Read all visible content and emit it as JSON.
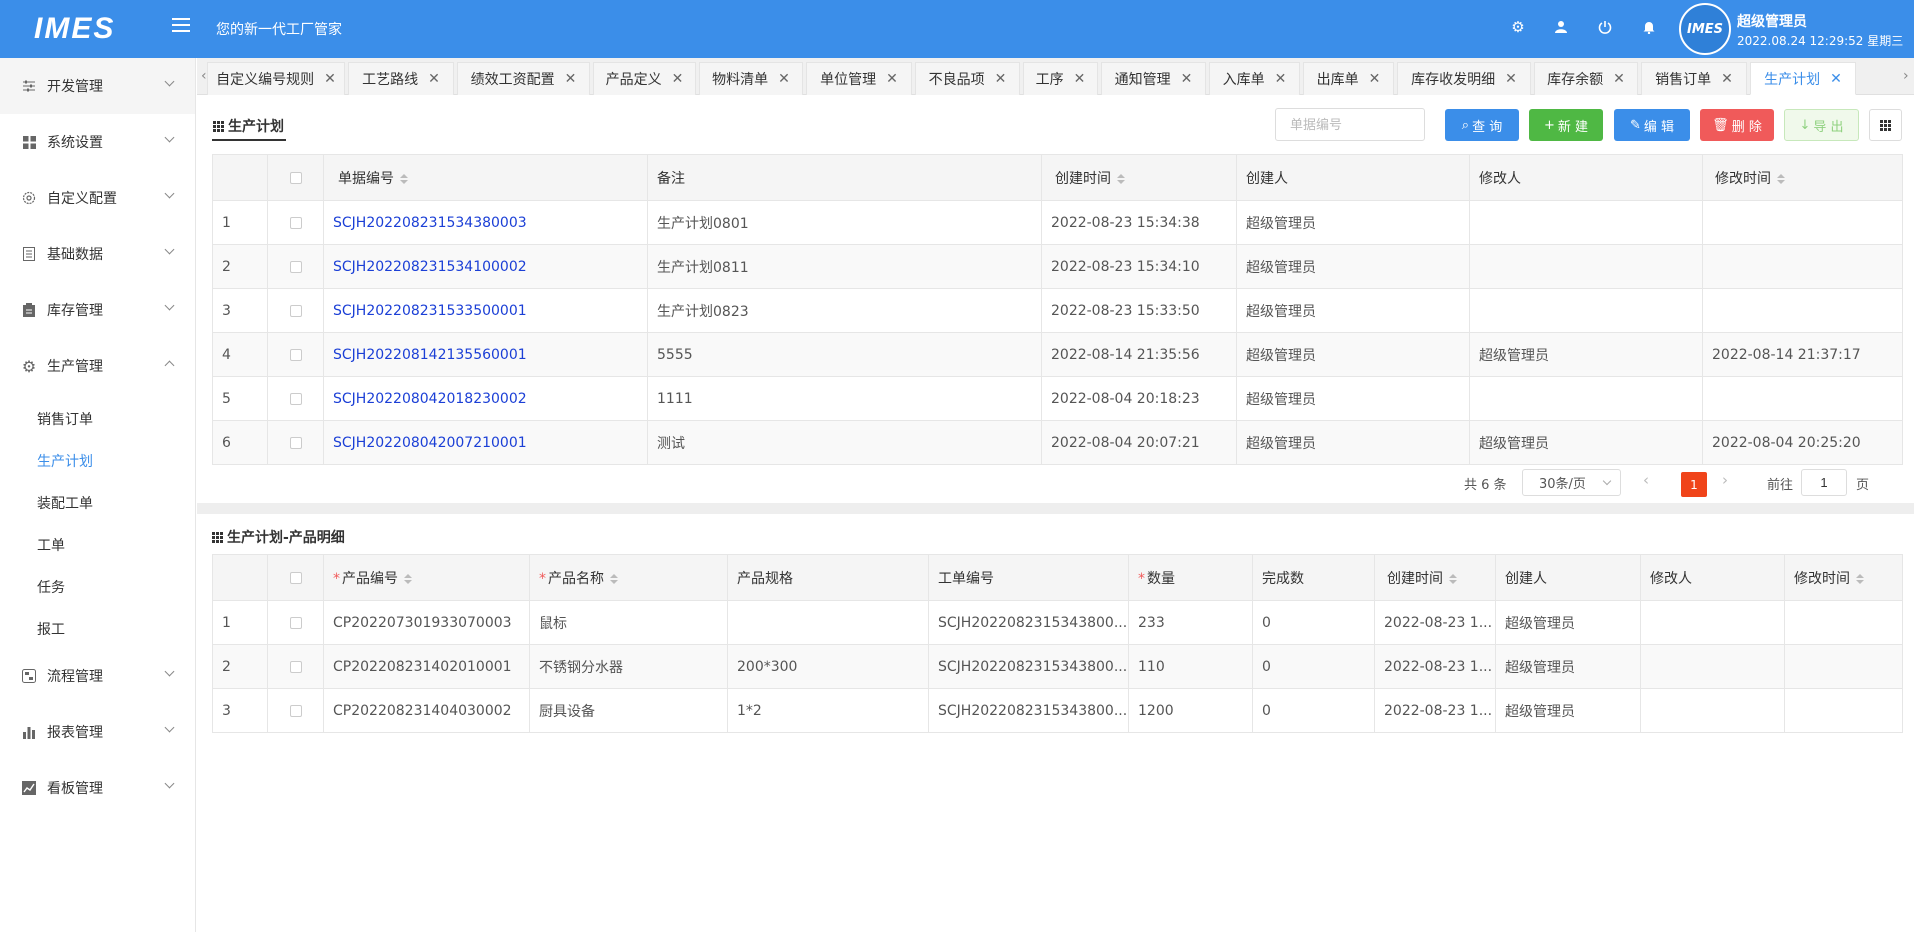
{
  "header": {
    "logo": "IMES",
    "slogan": "您的新一代工厂管家",
    "user_name": "超级管理员",
    "datetime": "2022.08.24 12:29:52 星期三",
    "avatar_text": "IMES"
  },
  "sidebar": {
    "menus": [
      {
        "label": "开发管理",
        "icon": "sliders-icon"
      },
      {
        "label": "系统设置",
        "icon": "grid-icon"
      },
      {
        "label": "自定义配置",
        "icon": "settings-icon"
      },
      {
        "label": "基础数据",
        "icon": "book-icon"
      },
      {
        "label": "库存管理",
        "icon": "clipboard-icon"
      },
      {
        "label": "生产管理",
        "icon": "gear-icon"
      },
      {
        "label": "流程管理",
        "icon": "flow-icon"
      },
      {
        "label": "报表管理",
        "icon": "bar-chart-icon"
      },
      {
        "label": "看板管理",
        "icon": "line-chart-icon"
      }
    ],
    "sub_items": [
      "销售订单",
      "生产计划",
      "装配工单",
      "工单",
      "任务",
      "报工"
    ],
    "active_sub": "生产计划"
  },
  "tabs": [
    "自定义编号规则",
    "工艺路线",
    "绩效工资配置",
    "产品定义",
    "物料清单",
    "单位管理",
    "不良品项",
    "工序",
    "通知管理",
    "入库单",
    "出库单",
    "库存收发明细",
    "库存余额",
    "销售订单",
    "生产计划"
  ],
  "active_tab": "生产计划",
  "plan": {
    "title": "生产计划",
    "search_placeholder": "单据编号",
    "buttons": {
      "query": "查 询",
      "new": "新 建",
      "edit": "编 辑",
      "delete": "删 除",
      "export": "导 出"
    },
    "columns": [
      "单据编号",
      "备注",
      "创建时间",
      "创建人",
      "修改人",
      "修改时间"
    ],
    "rows": [
      {
        "idx": "1",
        "code": "SCJH202208231534380003",
        "remark": "生产计划0801",
        "created": "2022-08-23 15:34:38",
        "creator": "超级管理员",
        "modifier": "",
        "modified": ""
      },
      {
        "idx": "2",
        "code": "SCJH202208231534100002",
        "remark": "生产计划0811",
        "created": "2022-08-23 15:34:10",
        "creator": "超级管理员",
        "modifier": "",
        "modified": ""
      },
      {
        "idx": "3",
        "code": "SCJH202208231533500001",
        "remark": "生产计划0823",
        "created": "2022-08-23 15:33:50",
        "creator": "超级管理员",
        "modifier": "",
        "modified": ""
      },
      {
        "idx": "4",
        "code": "SCJH202208142135560001",
        "remark": "5555",
        "created": "2022-08-14 21:35:56",
        "creator": "超级管理员",
        "modifier": "超级管理员",
        "modified": "2022-08-14 21:37:17"
      },
      {
        "idx": "5",
        "code": "SCJH202208042018230002",
        "remark": "1111",
        "created": "2022-08-04 20:18:23",
        "creator": "超级管理员",
        "modifier": "",
        "modified": ""
      },
      {
        "idx": "6",
        "code": "SCJH202208042007210001",
        "remark": "测试",
        "created": "2022-08-04 20:07:21",
        "creator": "超级管理员",
        "modifier": "超级管理员",
        "modified": "2022-08-04 20:25:20"
      }
    ],
    "pagination": {
      "total": "共 6 条",
      "page_size": "30条/页",
      "current": "1",
      "goto_label": "前往",
      "goto_value": "1",
      "page_label": "页"
    }
  },
  "detail": {
    "title": "生产计划-产品明细",
    "columns": [
      "产品编号",
      "产品名称",
      "产品规格",
      "工单编号",
      "数量",
      "完成数",
      "创建时间",
      "创建人",
      "修改人",
      "修改时间"
    ],
    "rows": [
      {
        "idx": "1",
        "code": "CP202207301933070003",
        "name": "鼠标",
        "spec": "",
        "order": "SCJH2022082315343800...",
        "qty": "233",
        "done": "0",
        "created": "2022-08-23 1...",
        "creator": "超级管理员",
        "modifier": "",
        "modified": ""
      },
      {
        "idx": "2",
        "code": "CP202208231402010001",
        "name": "不锈钢分水器",
        "spec": "200*300",
        "order": "SCJH2022082315343800...",
        "qty": "110",
        "done": "0",
        "created": "2022-08-23 1...",
        "creator": "超级管理员",
        "modifier": "",
        "modified": ""
      },
      {
        "idx": "3",
        "code": "CP202208231404030002",
        "name": "厨具设备",
        "spec": "1*2",
        "order": "SCJH2022082315343800...",
        "qty": "1200",
        "done": "0",
        "created": "2022-08-23 1...",
        "creator": "超级管理员",
        "modifier": "",
        "modified": ""
      }
    ]
  },
  "colors": {
    "primary": "#3b8ee9",
    "success": "#4fb844",
    "danger": "#f05a5a",
    "link": "#1b3fd6",
    "page_active": "#f0441a"
  }
}
